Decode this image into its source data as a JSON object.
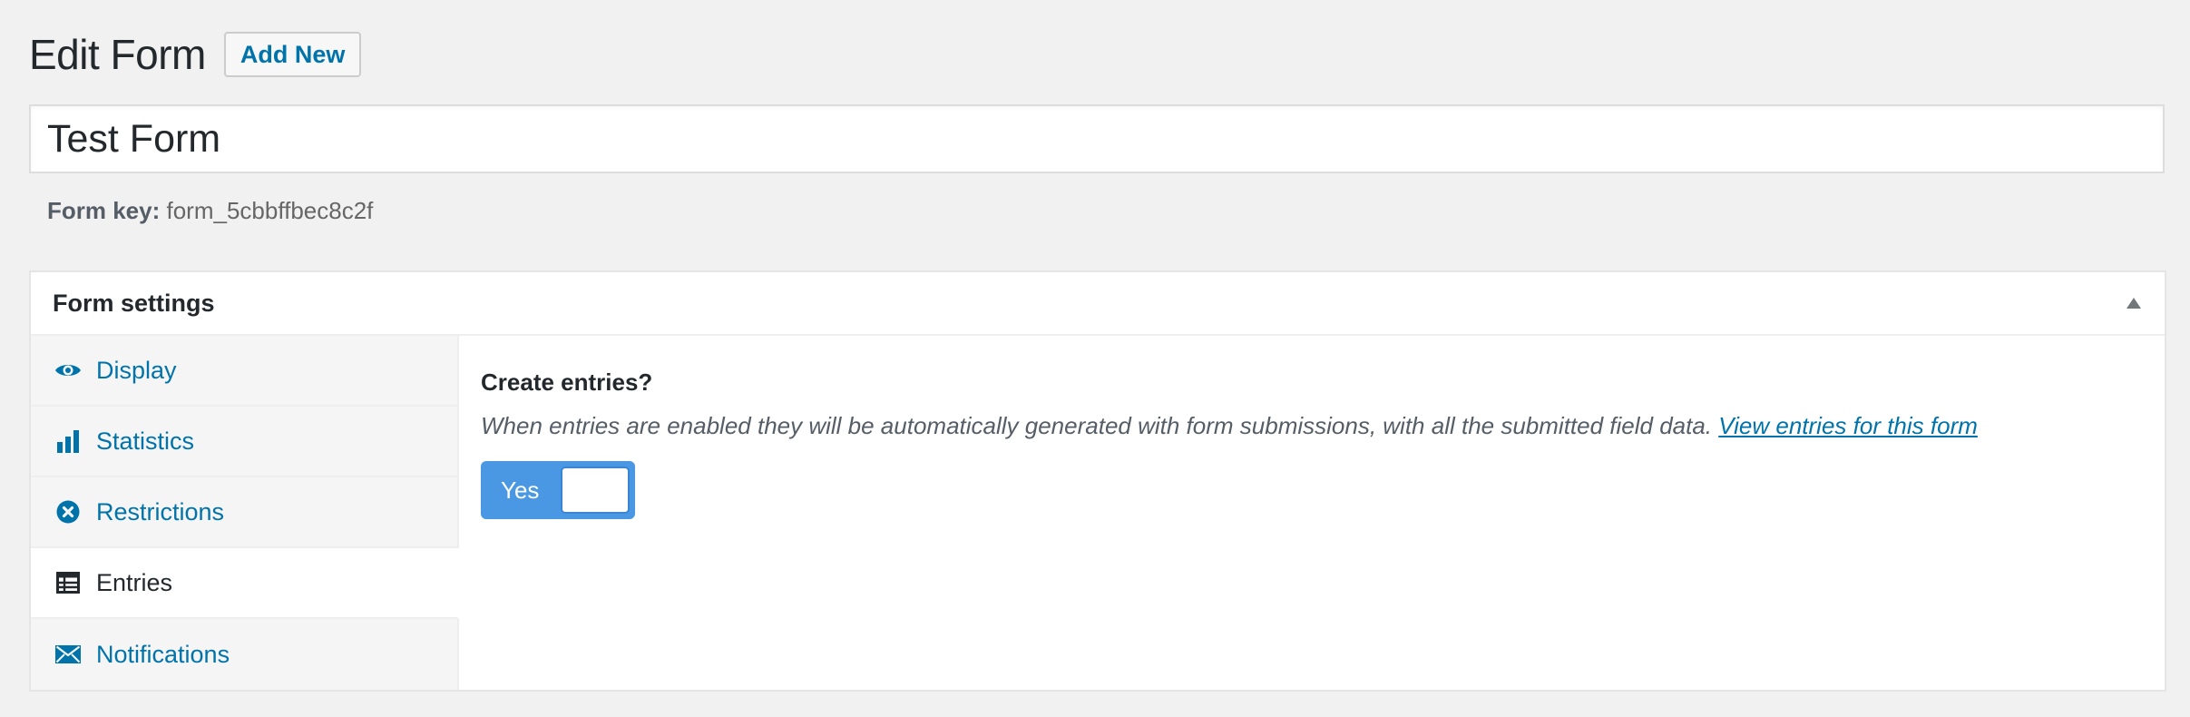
{
  "header": {
    "title": "Edit Form",
    "add_new_label": "Add New"
  },
  "form": {
    "title_value": "Test Form",
    "key_label": "Form key:",
    "key_value": "form_5cbbffbec8c2f"
  },
  "settings": {
    "title": "Form settings",
    "tabs": [
      {
        "label": "Display",
        "icon": "eye-icon",
        "active": false
      },
      {
        "label": "Statistics",
        "icon": "bar-chart-icon",
        "active": false
      },
      {
        "label": "Restrictions",
        "icon": "circle-x-icon",
        "active": false
      },
      {
        "label": "Entries",
        "icon": "table-icon",
        "active": true
      },
      {
        "label": "Notifications",
        "icon": "envelope-icon",
        "active": false
      }
    ],
    "panel": {
      "heading": "Create entries?",
      "description": "When entries are enabled they will be automatically generated with form submissions, with all the submitted field data.",
      "link_text": "View entries for this form",
      "toggle_label": "Yes",
      "toggle_on": true
    }
  },
  "colors": {
    "link": "#0073aa",
    "toggle": "#4a98e4",
    "background": "#f1f1f1"
  }
}
